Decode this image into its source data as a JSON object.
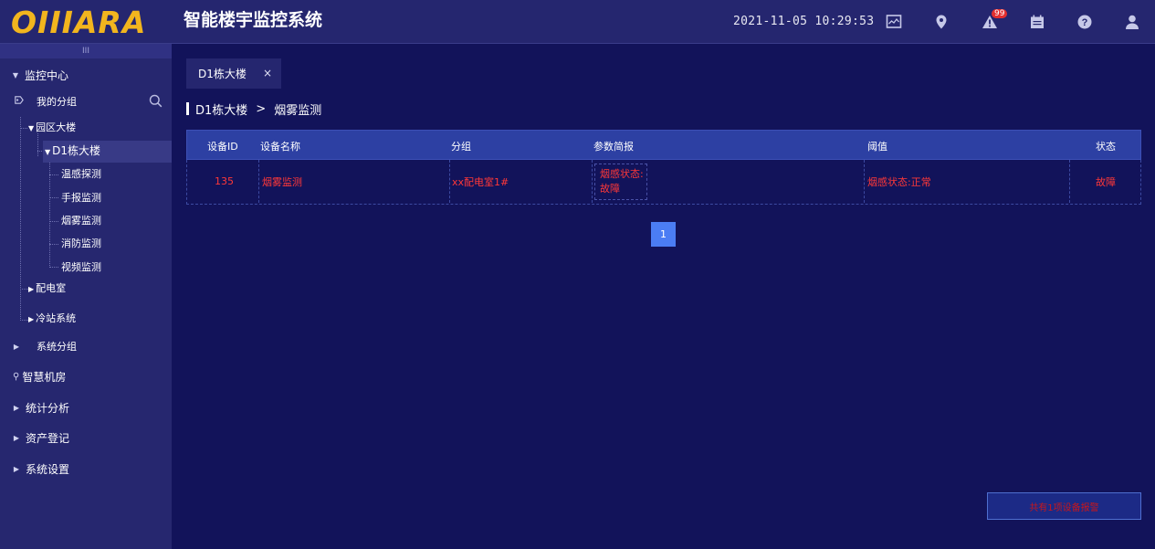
{
  "header": {
    "logo": "OIIIARA",
    "title": "智能楼宇监控系统",
    "datetime": "2021-11-05 10:29:53",
    "alarm_count": "99",
    "icons": [
      "monitor-icon",
      "location-icon",
      "warning-icon",
      "calendar-icon",
      "help-icon",
      "user-icon"
    ]
  },
  "sidebar": {
    "collapse_glyph": "III",
    "monitor_center": "监控中心",
    "my_group": "我的分组",
    "tree": {
      "park_building": "园区大楼",
      "d1_building": "D1栋大楼",
      "children": [
        "温感探测",
        "手报监测",
        "烟雾监测",
        "消防监测",
        "视频监测"
      ],
      "power_room": "配电室",
      "cooling_system": "冷站系统"
    },
    "system_group": "系统分组",
    "menu": [
      "智慧机房",
      "统计分析",
      "资产登记",
      "系统设置"
    ]
  },
  "tab": {
    "label": "D1栋大楼",
    "close": "×"
  },
  "breadcrumb": {
    "parent": "D1栋大楼",
    "separator": ">",
    "current": "烟雾监测"
  },
  "table": {
    "headers": [
      "设备ID",
      "设备名称",
      "分组",
      "参数简报",
      "阈值",
      "状态"
    ],
    "rows": [
      {
        "id": "135",
        "name": "烟雾监测",
        "group": "xx配电室1#",
        "param_line1": "烟感状态:",
        "param_line2": "故障",
        "threshold": "烟感状态:正常",
        "status": "故障"
      }
    ]
  },
  "pagination": {
    "current": "1"
  },
  "alarm_button": {
    "label": "共有1项设备报警"
  },
  "colors": {
    "accent": "#f2b51e",
    "alert": "#ff3838",
    "primary": "#4b7df4",
    "background": "#12135a",
    "sidebar": "#26276f"
  }
}
